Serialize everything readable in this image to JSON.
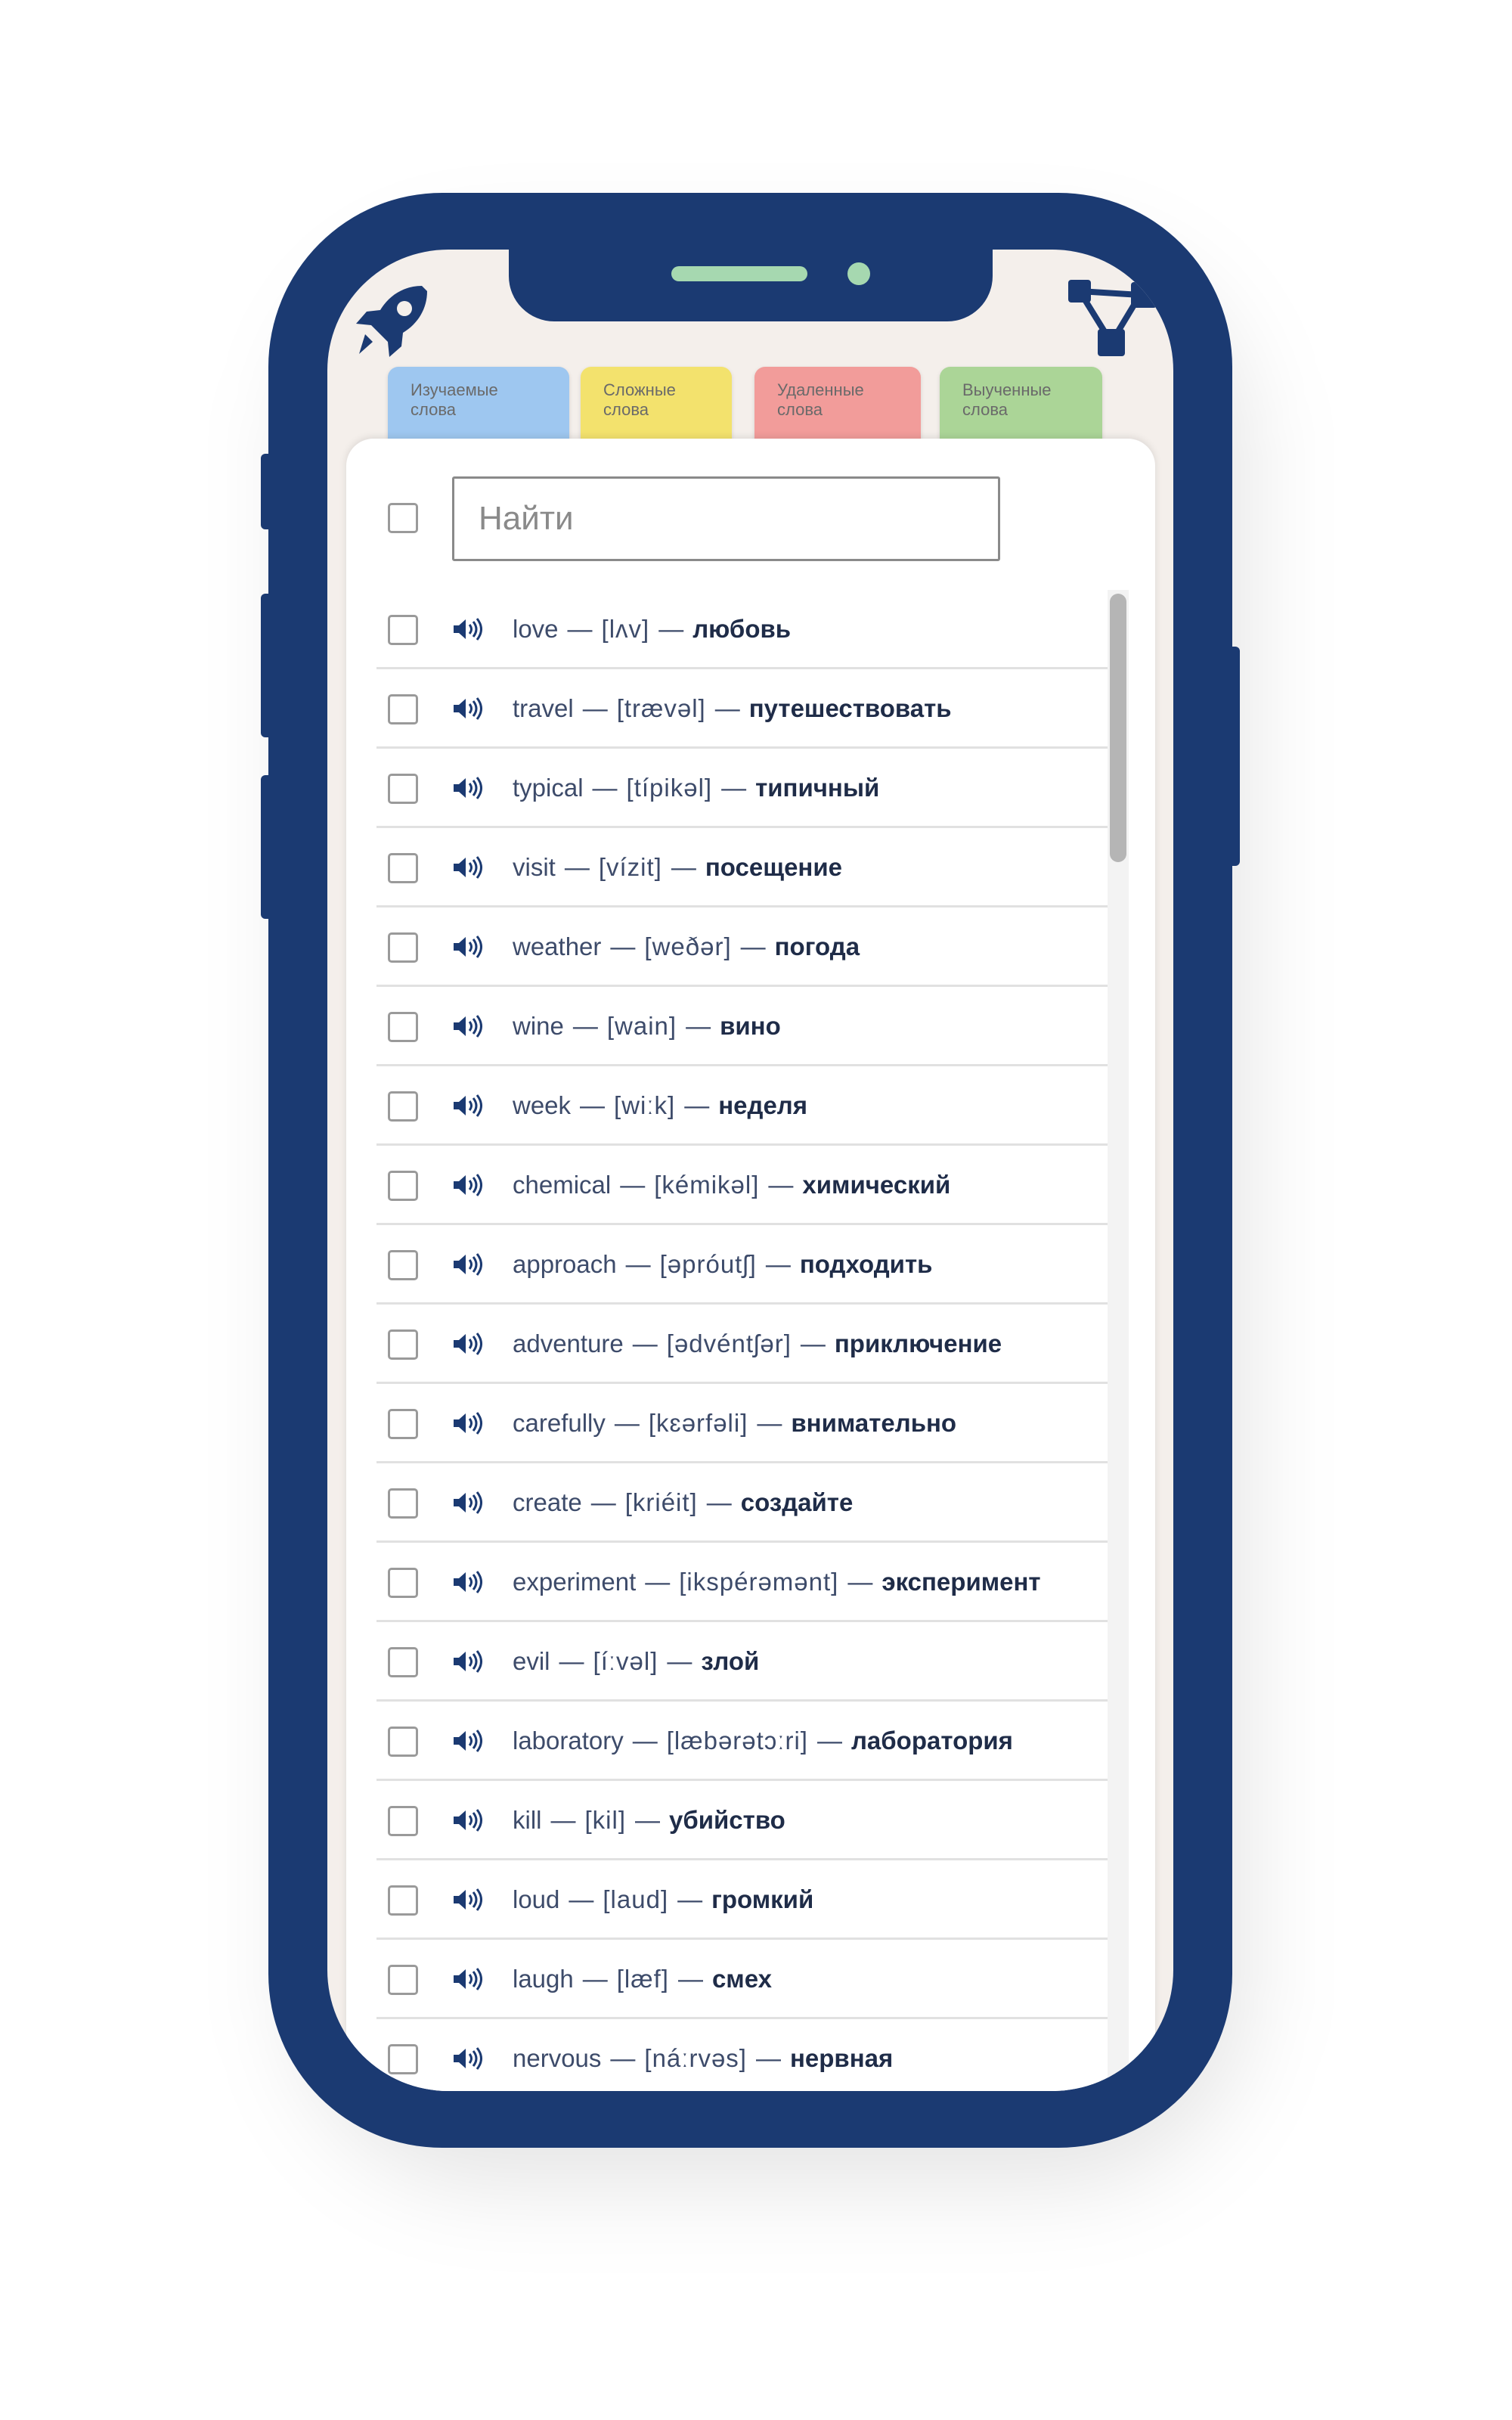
{
  "tabs": [
    {
      "label": "Изучаемые слова"
    },
    {
      "label": "Сложные слова"
    },
    {
      "label": "Удаленные слова"
    },
    {
      "label": "Выученные слова"
    }
  ],
  "search": {
    "placeholder": "Найти"
  },
  "icons": {
    "rocket": "rocket-icon",
    "share": "share-icon",
    "speaker": "speaker-icon"
  },
  "colors": {
    "phone_frame": "#1b3a72",
    "tab_blue": "#9ec7f0",
    "tab_yellow": "#f3e26d",
    "tab_red": "#f29c9a",
    "tab_green": "#abd597"
  },
  "words": [
    {
      "word": "love",
      "transcription": "[lʌv]",
      "translation": "любовь"
    },
    {
      "word": "travel",
      "transcription": "[trævəl]",
      "translation": "путешествовать"
    },
    {
      "word": "typical",
      "transcription": "[típikəl]",
      "translation": "типичный"
    },
    {
      "word": "visit",
      "transcription": "[vízit]",
      "translation": "посещение"
    },
    {
      "word": "weather",
      "transcription": "[weðər]",
      "translation": "погода"
    },
    {
      "word": "wine",
      "transcription": "[wain]",
      "translation": "вино"
    },
    {
      "word": "week",
      "transcription": "[wiːk]",
      "translation": "неделя"
    },
    {
      "word": "chemical",
      "transcription": "[kémikəl]",
      "translation": "химический"
    },
    {
      "word": "approach",
      "transcription": "[əpróutʃ]",
      "translation": "подходить"
    },
    {
      "word": "adventure",
      "transcription": "[ədvéntʃər]",
      "translation": "приключение"
    },
    {
      "word": "carefully",
      "transcription": "[kɛərfəli]",
      "translation": "внимательно"
    },
    {
      "word": "create",
      "transcription": "[kriéit]",
      "translation": "создайте"
    },
    {
      "word": "experiment",
      "transcription": "[ikspérəmənt]",
      "translation": "эксперимент"
    },
    {
      "word": "evil",
      "transcription": "[íːvəl]",
      "translation": "злой"
    },
    {
      "word": "laboratory",
      "transcription": "[læbərətɔːri]",
      "translation": "лаборатория"
    },
    {
      "word": "kill",
      "transcription": "[kil]",
      "translation": "убийство"
    },
    {
      "word": "loud",
      "transcription": "[laud]",
      "translation": "громкий"
    },
    {
      "word": "laugh",
      "transcription": "[læf]",
      "translation": "смех"
    },
    {
      "word": "nervous",
      "transcription": "[náːrvəs]",
      "translation": "нервная"
    }
  ]
}
